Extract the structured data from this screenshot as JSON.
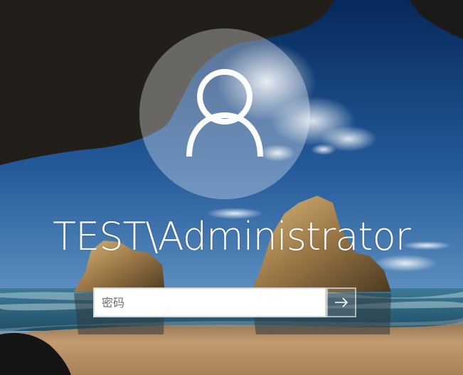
{
  "login": {
    "username": "TEST\\Administrator",
    "password_placeholder": "密码",
    "submit_icon": "arrow-right-icon",
    "avatar_icon": "user-silhouette-icon"
  },
  "background": {
    "description_icon": "sea-cave-landscape",
    "colors": {
      "sky_top": "#0a2f63",
      "sky_mid": "#3f79b4",
      "sea": "#2c6a8c",
      "sand": "#b8946a",
      "cave": "#151515"
    }
  }
}
